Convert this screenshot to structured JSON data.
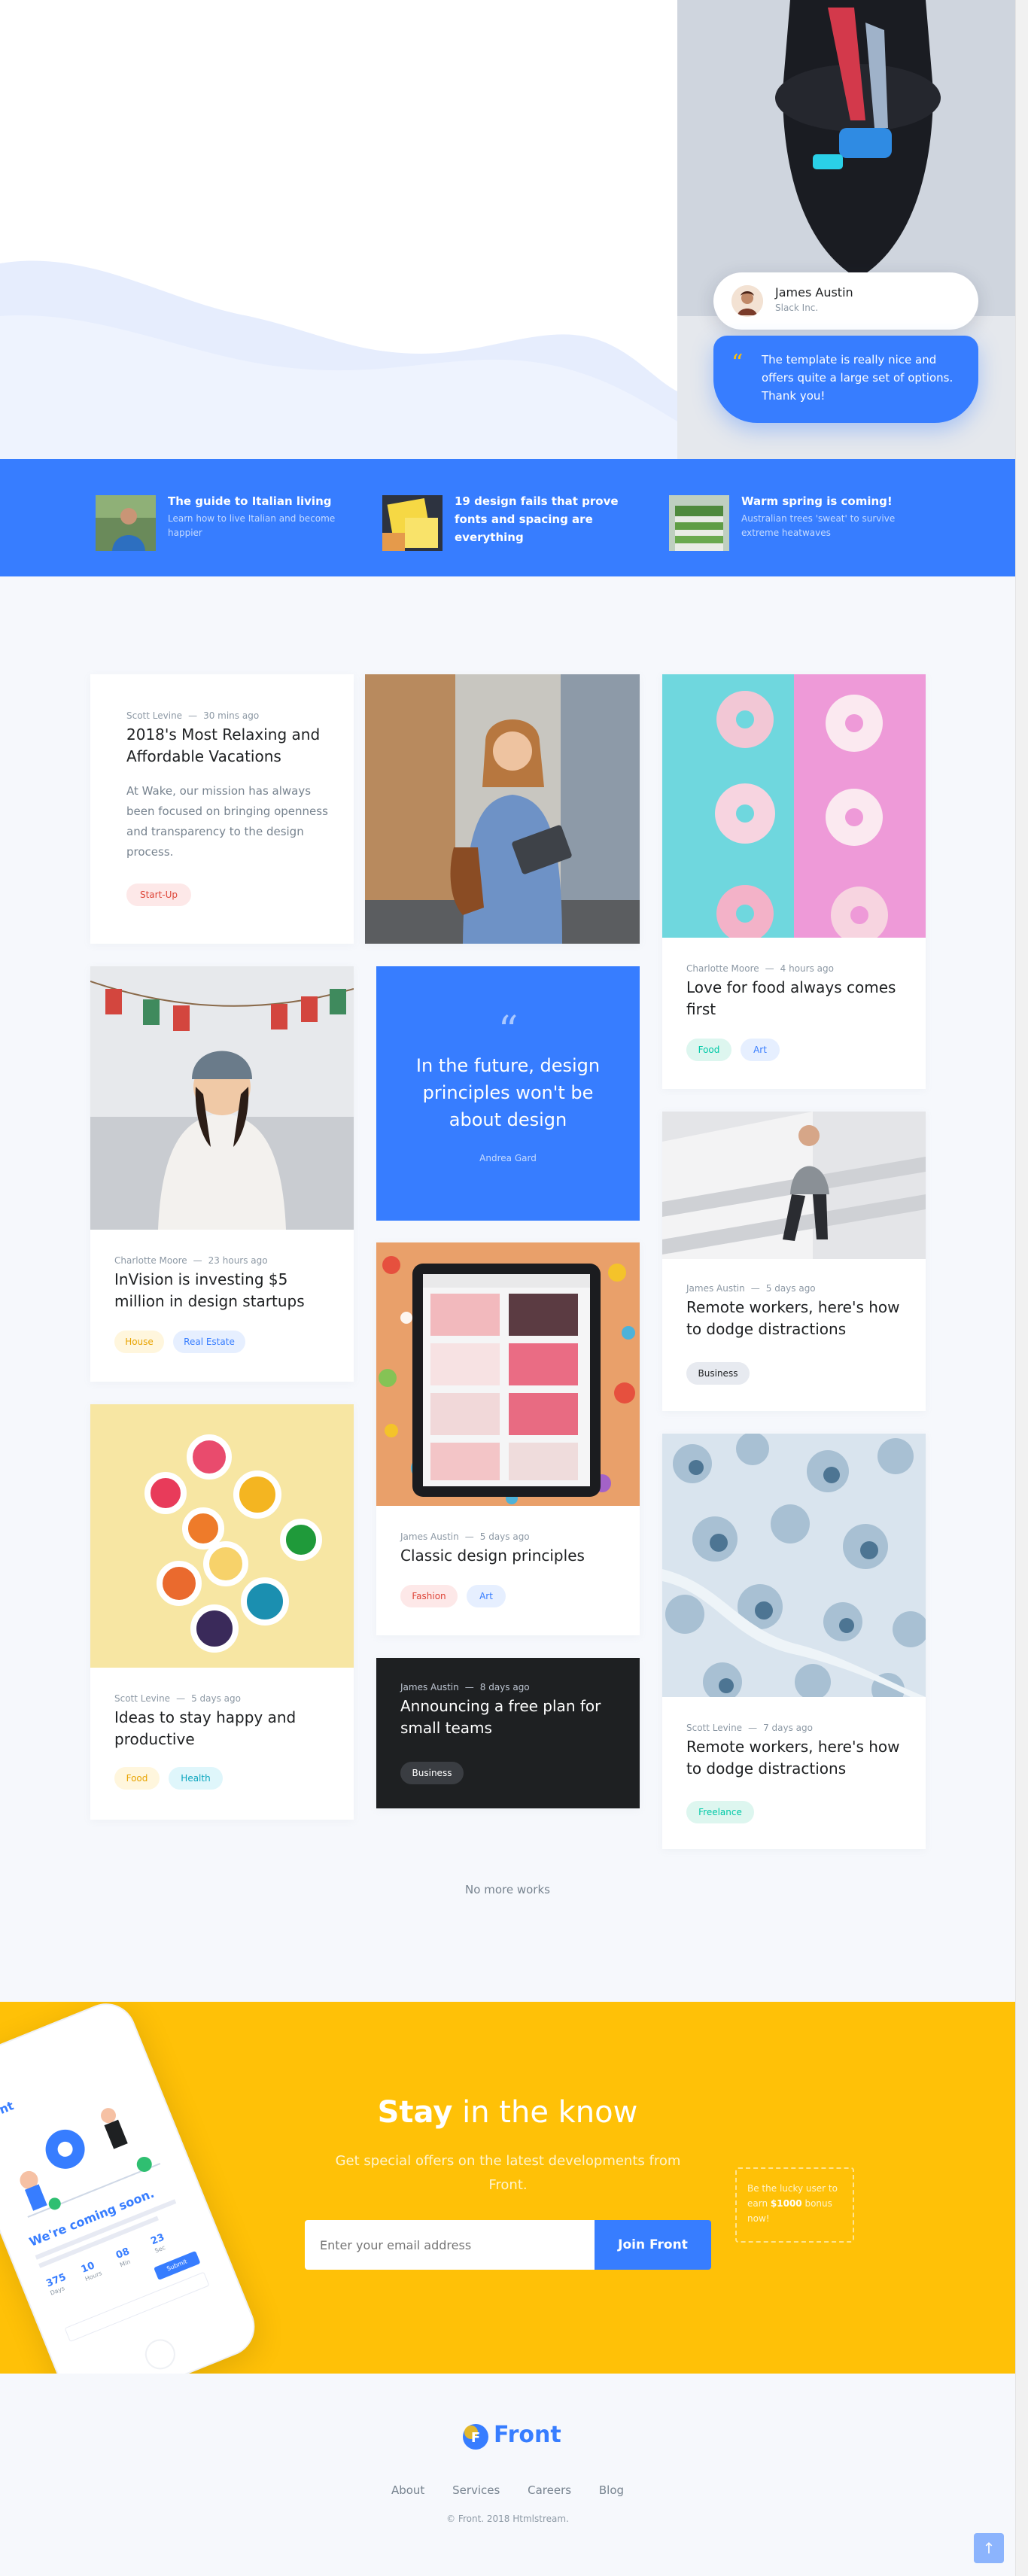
{
  "testimonial": {
    "name": "James Austin",
    "company": "Slack Inc.",
    "quote_mark": "“",
    "text": "The template is really nice and offers quite a large set of options. Thank you!"
  },
  "strip": [
    {
      "title": "The guide to Italian living",
      "sub": "Learn how to live Italian and become happier"
    },
    {
      "title": "19 design fails that prove fonts and spacing are everything",
      "sub": ""
    },
    {
      "title": "Warm spring is coming!",
      "sub": "Australian trees 'sweat' to survive extreme heatwaves"
    }
  ],
  "cards": {
    "vacations": {
      "author": "Scott Levine",
      "time": "30 mins ago",
      "title": "2018's Most Relaxing and Affordable Vacations",
      "text": "At Wake, our mission has always been focused on bringing openness and transparency to the design process.",
      "tag": "Start-Up"
    },
    "food": {
      "author": "Charlotte Moore",
      "time": "4 hours ago",
      "title": "Love for food always comes first",
      "tags": [
        "Food",
        "Art"
      ]
    },
    "invision": {
      "author": "Charlotte Moore",
      "time": "23 hours ago",
      "title": "InVision is investing $5 million in design startups",
      "tags": [
        "House",
        "Real Estate"
      ]
    },
    "quote": {
      "mark": "“",
      "text": "In the future, design principles won't be about design",
      "author": "Andrea Gard"
    },
    "remote1": {
      "author": "James Austin",
      "time": "5 days ago",
      "title": "Remote workers, here's how to dodge distractions",
      "tag": "Business"
    },
    "classic": {
      "author": "James Austin",
      "time": "5 days ago",
      "title": "Classic design principles",
      "tags": [
        "Fashion",
        "Art"
      ]
    },
    "happy": {
      "author": "Scott Levine",
      "time": "5 days ago",
      "title": "Ideas to stay happy and productive",
      "tags": [
        "Food",
        "Health"
      ]
    },
    "freeplan": {
      "author": "James Austin",
      "time": "8 days ago",
      "title": "Announcing a free plan for small teams",
      "tag": "Business"
    },
    "remote2": {
      "author": "Scott Levine",
      "time": "7 days ago",
      "title": "Remote workers, here's how to dodge distractions",
      "tag": "Freelance"
    }
  },
  "meta_dash": "—",
  "no_more": "No more works",
  "newsletter": {
    "title_bold": "Stay",
    "title_rest": " in the know",
    "subtitle": "Get special offers on the latest developments from Front.",
    "placeholder": "Enter your email address",
    "button": "Join Front",
    "note_pre": "Be the lucky user to earn ",
    "note_bold": "$1000",
    "note_post": " bonus now!"
  },
  "phone": {
    "brand": "Front",
    "headline": "We're coming soon.",
    "counters": [
      "375",
      "10",
      "08",
      "23"
    ],
    "counter_units": [
      "Days",
      "Hours",
      "Min",
      "Sec"
    ],
    "button": "Submit"
  },
  "footer": {
    "logo": "Front",
    "logo_letter": "F",
    "links": [
      "About",
      "Services",
      "Careers",
      "Blog"
    ],
    "copyright": "© Front. 2018 Htmlstream."
  },
  "back_to_top": "↑",
  "colors": {
    "primary": "#377dff",
    "warning": "#ffc107",
    "dark": "#1e2022"
  }
}
